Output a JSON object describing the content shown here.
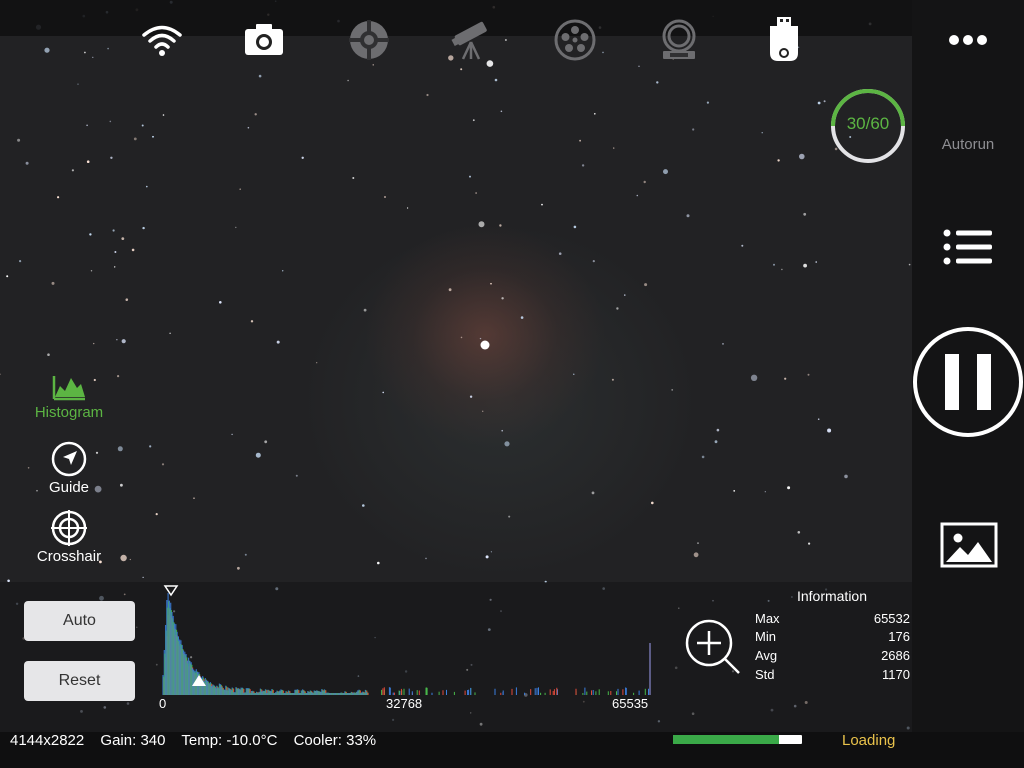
{
  "toolbar": {
    "icons": [
      "wifi-icon",
      "camera-icon",
      "guider-icon",
      "telescope-icon",
      "filter-wheel-icon",
      "focuser-icon",
      "usb-storage-icon"
    ]
  },
  "sequence": {
    "progress_label": "30/60",
    "current": 30,
    "total": 60,
    "autorun_label": "Autorun"
  },
  "left_tools": [
    {
      "label": "Histogram",
      "icon": "histogram-icon",
      "active": true
    },
    {
      "label": "Guide",
      "icon": "guide-compass-icon",
      "active": false
    },
    {
      "label": "Crosshair",
      "icon": "crosshair-icon",
      "active": false
    }
  ],
  "buttons": {
    "auto": "Auto",
    "reset": "Reset"
  },
  "histogram": {
    "ticks": [
      "0",
      "32768",
      "65535"
    ]
  },
  "info": {
    "title": "Information",
    "rows": [
      {
        "label": "Max",
        "value": "65532"
      },
      {
        "label": "Min",
        "value": "176"
      },
      {
        "label": "Avg",
        "value": "2686"
      },
      {
        "label": "Std",
        "value": "1170"
      }
    ]
  },
  "status": {
    "resolution": "4144x2822",
    "gain": "Gain: 340",
    "temp": "Temp: -10.0°C",
    "cooler": "Cooler: 33%",
    "loading_label": "Loading",
    "loading_progress": 0.82
  },
  "colors": {
    "accent_green": "#5cb543",
    "loading_yellow": "#e9c24b",
    "loading_bar": "#3aa948"
  }
}
